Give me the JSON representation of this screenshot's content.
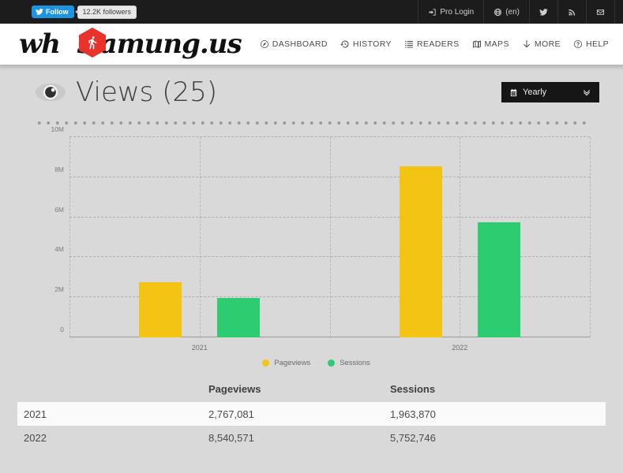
{
  "topbar": {
    "twitter_follow_label": "Follow",
    "twitter_follow_count": "12.2K followers",
    "nav": [
      {
        "label": "Pro Login",
        "icon": "login-icon"
      },
      {
        "label": "(en)",
        "icon": "globe-icon"
      },
      {
        "label": "",
        "icon": "twitter-icon"
      },
      {
        "label": "",
        "icon": "rss-icon"
      },
      {
        "label": "",
        "icon": "mail-icon"
      }
    ]
  },
  "header": {
    "logo_pre": "wh",
    "logo_post": "s.amung.us",
    "logo_icon": "walking-person-hex-icon",
    "nav": [
      {
        "label": "DASHBOARD",
        "icon": "dashboard-icon"
      },
      {
        "label": "HISTORY",
        "icon": "history-clock-icon"
      },
      {
        "label": "READERS",
        "icon": "list-icon"
      },
      {
        "label": "MAPS",
        "icon": "map-icon"
      },
      {
        "label": "MORE",
        "icon": "arrow-down-icon"
      },
      {
        "label": "HELP",
        "icon": "question-circle-icon"
      }
    ]
  },
  "main": {
    "title": "Views (25)",
    "title_icon": "eye-icon",
    "range_selector": {
      "value": "Yearly",
      "icon": "calendar-icon",
      "chevron": "chevron-double-down-icon",
      "options": [
        "Yearly"
      ]
    }
  },
  "colors": {
    "pageviews": "#F4C414",
    "sessions": "#2ECC71",
    "page_bg": "#d9d9d9",
    "topbar_bg": "#1c1c1c",
    "header_bg": "#ffffff",
    "highlight_row_bg": "#fafafa"
  },
  "chart_data": {
    "type": "bar",
    "title": "Views (25)",
    "categories": [
      "2021",
      "2022"
    ],
    "series": [
      {
        "name": "Pageviews",
        "color": "#F4C414",
        "values": [
          2767081,
          8540571
        ]
      },
      {
        "name": "Sessions",
        "color": "#2ECC71",
        "values": [
          1963870,
          5752746
        ]
      }
    ],
    "xlabel": "",
    "ylabel": "",
    "ylim": [
      0,
      10000000
    ],
    "yticks": [
      0,
      2000000,
      4000000,
      6000000,
      8000000,
      10000000
    ],
    "ytick_labels": [
      "0",
      "2M",
      "4M",
      "6M",
      "8M",
      "10M"
    ],
    "grid": true,
    "legend_position": "bottom"
  },
  "table": {
    "columns": [
      "",
      "Pageviews",
      "Sessions"
    ],
    "rows": [
      {
        "year": "2021",
        "pageviews": "2,767,081",
        "sessions": "1,963,870",
        "highlight": true
      },
      {
        "year": "2022",
        "pageviews": "8,540,571",
        "sessions": "5,752,746",
        "highlight": false
      }
    ]
  }
}
